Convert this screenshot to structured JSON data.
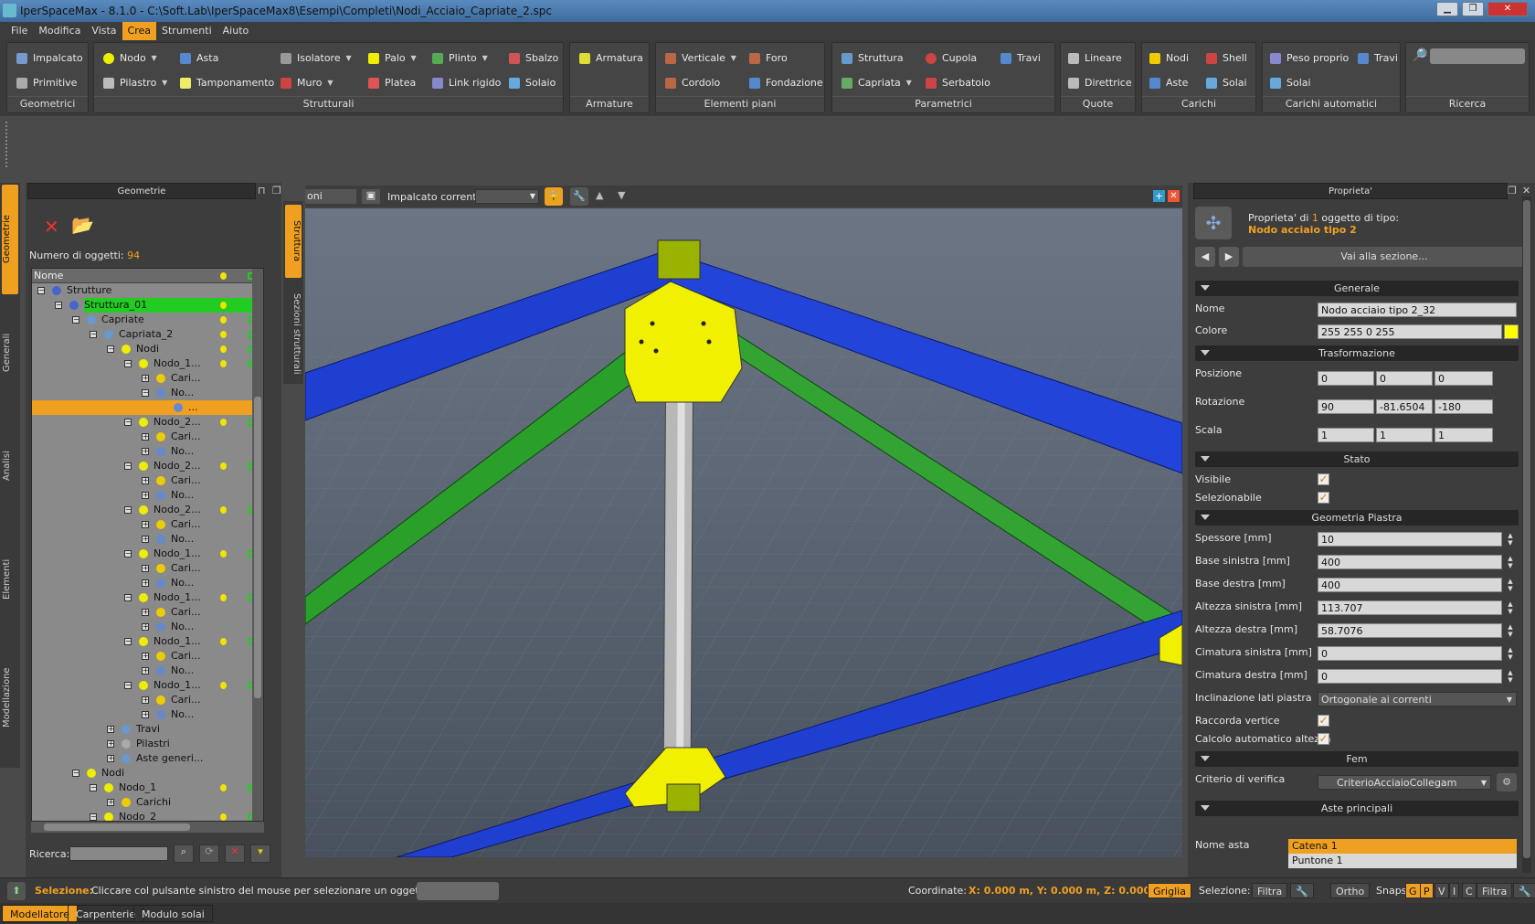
{
  "window": {
    "title": "IperSpaceMax - 8.1.0 - C:\\Soft.Lab\\IperSpaceMax8\\Esempi\\Completi\\Nodi_Acciaio_Capriate_2.spc"
  },
  "menu": [
    "File",
    "Modifica",
    "Vista",
    "Crea",
    "Strumenti",
    "Aiuto"
  ],
  "menu_active": "Crea",
  "ribbon": {
    "groups": {
      "geometrici": "Geometrici",
      "strutturali": "Strutturali",
      "armature": "Armature",
      "elementi": "Elementi piani",
      "parametrici": "Parametrici",
      "quote": "Quote",
      "carichi": "Carichi",
      "carichi_auto": "Carichi automatici",
      "ricerca": "Ricerca"
    },
    "b": {
      "impalcato": "Impalcato",
      "primitive": "Primitive",
      "nodo": "Nodo",
      "asta": "Asta",
      "isolatore": "Isolatore",
      "palo": "Palo",
      "plinto": "Plinto",
      "sbalzo": "Sbalzo",
      "pilastro": "Pilastro",
      "tamponamento": "Tamponamento",
      "muro": "Muro",
      "platea": "Platea",
      "link": "Link rigido",
      "solaio": "Solaio",
      "armatura": "Armatura",
      "verticale": "Verticale",
      "foro": "Foro",
      "cordolo": "Cordolo",
      "fondazione": "Fondazione",
      "struttura": "Struttura",
      "cupola": "Cupola",
      "travi": "Travi",
      "capriata": "Capriata",
      "serbatoio": "Serbatoio",
      "lineare": "Lineare",
      "direttrice": "Direttrice",
      "nodi": "Nodi",
      "shell": "Shell",
      "aste": "Aste",
      "solai": "Solai",
      "peso": "Peso proprio",
      "travi2": "Travi",
      "solai2": "Solai"
    }
  },
  "geometry_panel": {
    "title": "Geometrie",
    "count_label": "Numero di oggetti:",
    "count_value": "94",
    "col_name": "Nome",
    "search_label": "Ricerca:"
  },
  "tree": [
    {
      "t": "Strutture",
      "d": 0,
      "box": "⊟",
      "ic": "#46c"
    },
    {
      "t": "Struttura_01",
      "d": 1,
      "box": "⊟",
      "ic": "#46c",
      "hl": "green"
    },
    {
      "t": "Capriate",
      "d": 2,
      "box": "⊟",
      "ic": "#69c"
    },
    {
      "t": "Capriata_2",
      "d": 3,
      "box": "⊟",
      "ic": "#69c"
    },
    {
      "t": "Nodi",
      "d": 4,
      "box": "⊟",
      "ic": "#ee0"
    },
    {
      "t": "Nodo_1...",
      "d": 5,
      "box": "⊟",
      "ic": "#ee0"
    },
    {
      "t": "Cari...",
      "d": 6,
      "box": "⊞",
      "ic": "#ec0"
    },
    {
      "t": "No...",
      "d": 6,
      "box": "⊟",
      "ic": "#68c"
    },
    {
      "t": "...",
      "d": 7,
      "box": "",
      "ic": "#68c",
      "sel": true
    },
    {
      "t": "Nodo_2...",
      "d": 5,
      "box": "⊟",
      "ic": "#ee0"
    },
    {
      "t": "Cari...",
      "d": 6,
      "box": "⊞",
      "ic": "#ec0"
    },
    {
      "t": "No...",
      "d": 6,
      "box": "⊞",
      "ic": "#68c"
    },
    {
      "t": "Nodo_2...",
      "d": 5,
      "box": "⊟",
      "ic": "#ee0"
    },
    {
      "t": "Cari...",
      "d": 6,
      "box": "⊞",
      "ic": "#ec0"
    },
    {
      "t": "No...",
      "d": 6,
      "box": "⊞",
      "ic": "#68c"
    },
    {
      "t": "Nodo_2...",
      "d": 5,
      "box": "⊟",
      "ic": "#ee0"
    },
    {
      "t": "Cari...",
      "d": 6,
      "box": "⊞",
      "ic": "#ec0"
    },
    {
      "t": "No...",
      "d": 6,
      "box": "⊞",
      "ic": "#68c"
    },
    {
      "t": "Nodo_1...",
      "d": 5,
      "box": "⊟",
      "ic": "#ee0"
    },
    {
      "t": "Cari...",
      "d": 6,
      "box": "⊞",
      "ic": "#ec0"
    },
    {
      "t": "No...",
      "d": 6,
      "box": "⊞",
      "ic": "#68c"
    },
    {
      "t": "Nodo_1...",
      "d": 5,
      "box": "⊟",
      "ic": "#ee0"
    },
    {
      "t": "Cari...",
      "d": 6,
      "box": "⊞",
      "ic": "#ec0"
    },
    {
      "t": "No...",
      "d": 6,
      "box": "⊞",
      "ic": "#68c"
    },
    {
      "t": "Nodo_1...",
      "d": 5,
      "box": "⊟",
      "ic": "#ee0"
    },
    {
      "t": "Cari...",
      "d": 6,
      "box": "⊞",
      "ic": "#ec0"
    },
    {
      "t": "No...",
      "d": 6,
      "box": "⊞",
      "ic": "#68c"
    },
    {
      "t": "Nodo_1...",
      "d": 5,
      "box": "⊟",
      "ic": "#ee0"
    },
    {
      "t": "Cari...",
      "d": 6,
      "box": "⊞",
      "ic": "#ec0"
    },
    {
      "t": "No...",
      "d": 6,
      "box": "⊞",
      "ic": "#68c"
    },
    {
      "t": "Travi",
      "d": 4,
      "box": "⊞",
      "ic": "#69c"
    },
    {
      "t": "Pilastri",
      "d": 4,
      "box": "⊞",
      "ic": "#aaa"
    },
    {
      "t": "Aste generi...",
      "d": 4,
      "box": "⊞",
      "ic": "#69c"
    },
    {
      "t": "Nodi",
      "d": 2,
      "box": "⊟",
      "ic": "#ee0"
    },
    {
      "t": "Nodo_1",
      "d": 3,
      "box": "⊟",
      "ic": "#ee0"
    },
    {
      "t": "Carichi",
      "d": 4,
      "box": "⊞",
      "ic": "#ec0"
    },
    {
      "t": "Nodo_2",
      "d": 3,
      "box": "⊟",
      "ic": "#ee0"
    }
  ],
  "side_tabs": [
    "Geometrie",
    "Generali",
    "Analisi",
    "Elementi",
    "Modellazione"
  ],
  "mid_tabs": [
    "Struttura",
    "Sezioni strutturali"
  ],
  "viewport_toolbar": {
    "views": "oni vista...",
    "impalcato_label": "Impalcato corrente:"
  },
  "properties": {
    "title": "Proprieta'",
    "header_line1_a": "Proprieta' di ",
    "header_count": "1",
    "header_line1_b": " oggetto di tipo:",
    "header_type": "Nodo acciaio tipo 2",
    "goto": "Vai alla sezione...",
    "sections": {
      "generale": "Generale",
      "trasf": "Trasformazione",
      "stato": "Stato",
      "geom": "Geometria Piastra",
      "fem": "Fem",
      "aste": "Aste principali"
    },
    "labels": {
      "nome": "Nome",
      "colore": "Colore",
      "posizione": "Posizione",
      "rotazione": "Rotazione",
      "scala": "Scala",
      "visibile": "Visibile",
      "selezionabile": "Selezionabile",
      "spessore": "Spessore [mm]",
      "base_sx": "Base sinistra [mm]",
      "base_dx": "Base destra [mm]",
      "alt_sx": "Altezza sinistra [mm]",
      "alt_dx": "Altezza destra [mm]",
      "cim_sx": "Cimatura sinistra [mm]",
      "cim_dx": "Cimatura destra [mm]",
      "incl": "Inclinazione lati piastra",
      "raccorda": "Raccorda vertice",
      "calcolo": "Calcolo automatico altezza",
      "criterio": "Criterio di verifica",
      "nome_asta": "Nome asta"
    },
    "values": {
      "nome": "Nodo acciaio tipo 2_32",
      "colore": "255 255 0 255",
      "color_hex": "#ffff00",
      "pos": [
        "0",
        "0",
        "0"
      ],
      "rot": [
        "90",
        "-81.6504",
        "-180"
      ],
      "scala": [
        "1",
        "1",
        "1"
      ],
      "spessore": "10",
      "base_sx": "400",
      "base_dx": "400",
      "alt_sx": "113.707",
      "alt_dx": "58.7076",
      "cim_sx": "0",
      "cim_dx": "0",
      "incl": "Ortogonale ai correnti",
      "criterio": "CriterioAcciaioCollegam",
      "aste": [
        "Catena 1",
        "Puntone 1"
      ]
    }
  },
  "status": {
    "sel_label": "Selezione:",
    "sel_text": "Cliccare col pulsante sinistro del mouse per selezionare un oggetto",
    "coord_label": "Coordinate:",
    "coord_value": "X: 0.000 m, Y: 0.000 m, Z: 0.000 m",
    "griglia": "Griglia",
    "selezione": "Selezione:",
    "filtra": "Filtra",
    "ortho": "Ortho",
    "snaps": "Snaps:",
    "snap_keys": [
      "G",
      "P",
      "V",
      "I",
      "C"
    ],
    "filtra2": "Filtra"
  },
  "bottom_tabs": [
    "Modellatore",
    "Carpenterie",
    "Modulo solai"
  ]
}
